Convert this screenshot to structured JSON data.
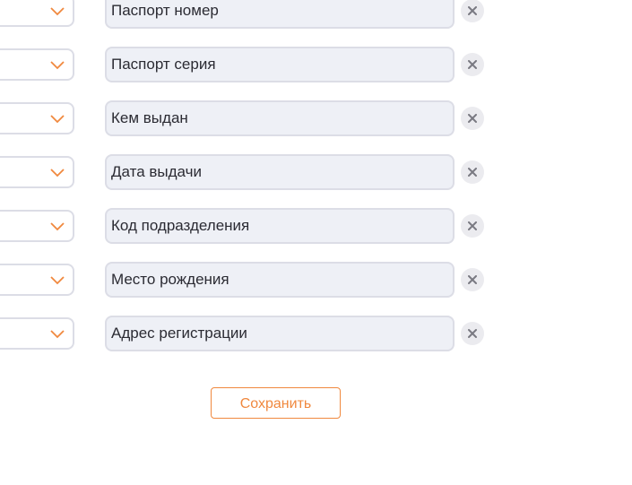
{
  "colors": {
    "accent": "#f0883e",
    "field_border": "#dcdde6",
    "field_background": "#eef0f6",
    "remove_button_background": "#ebebef",
    "remove_icon": "#7a7a82",
    "text": "#2b2b33"
  },
  "fields": [
    {
      "label": "Паспорт номер"
    },
    {
      "label": "Паспорт серия"
    },
    {
      "label": "Кем выдан"
    },
    {
      "label": "Дата выдачи"
    },
    {
      "label": "Код подразделения"
    },
    {
      "label": "Место рождения"
    },
    {
      "label": "Адрес регистрации"
    }
  ],
  "icons": {
    "dropdown": "chevron-down-icon",
    "remove": "close-icon"
  },
  "save_button": {
    "label": "Сохранить"
  }
}
